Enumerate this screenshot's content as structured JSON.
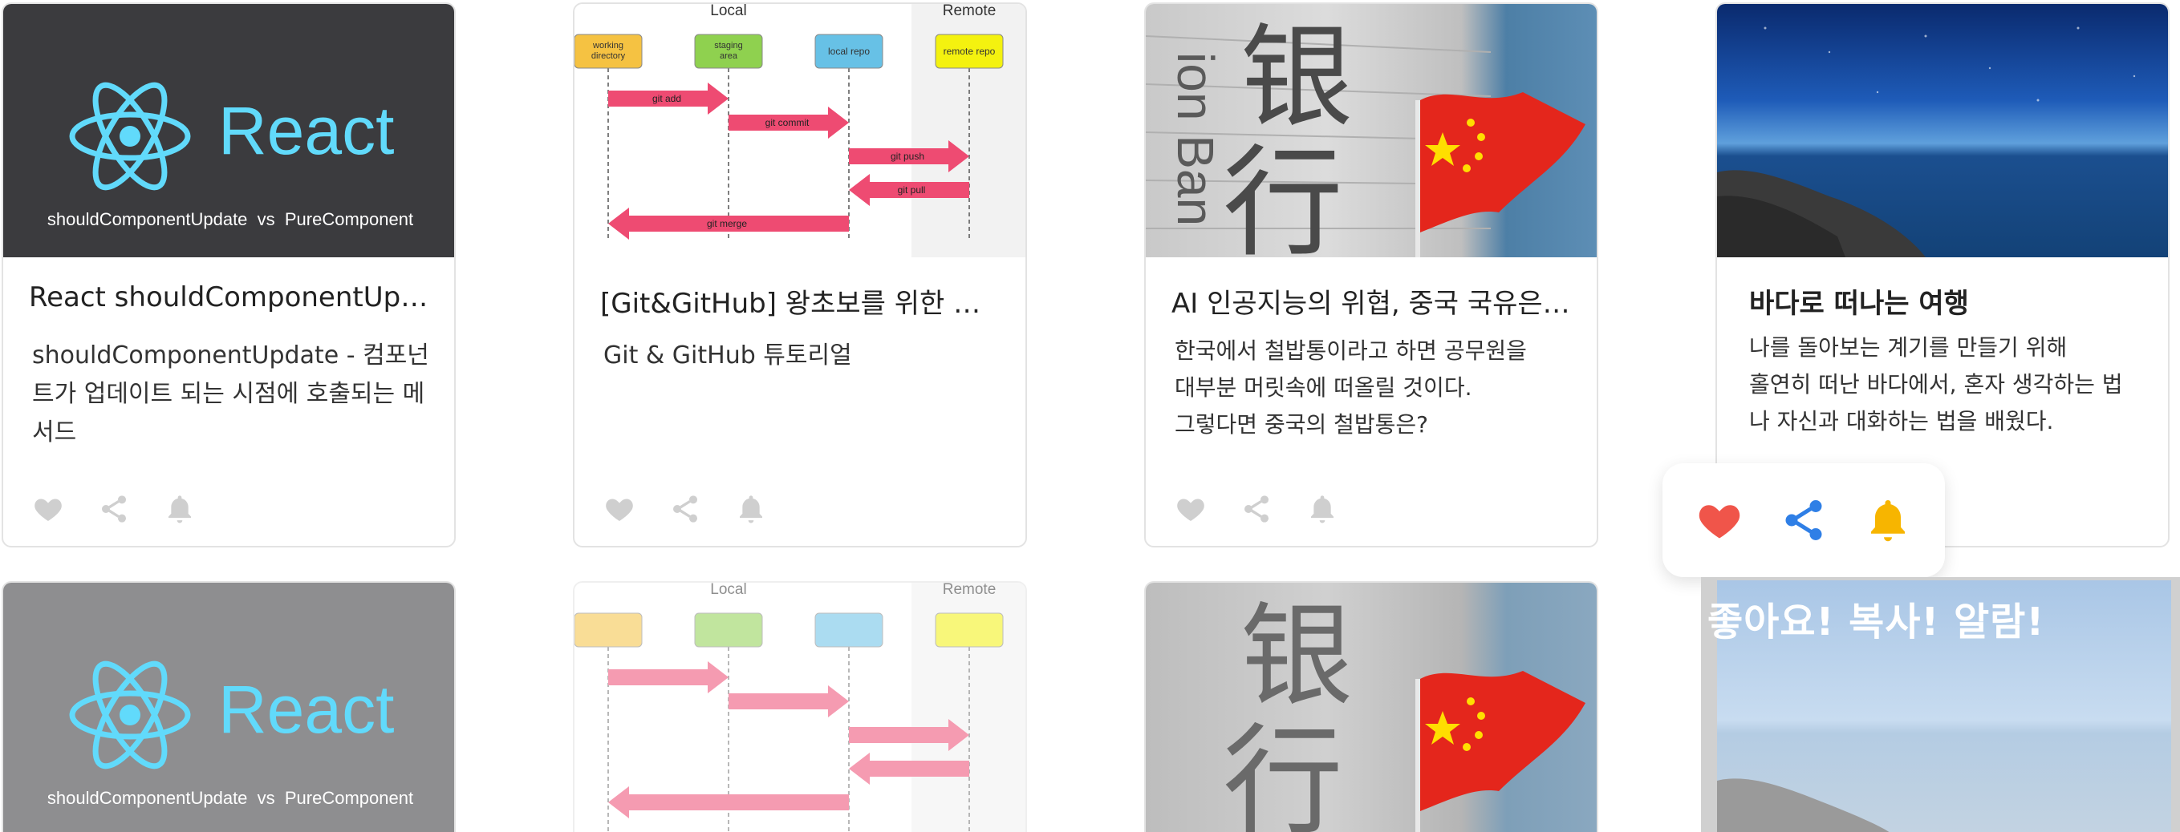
{
  "row1": [
    {
      "title": "React shouldComponentUpda…",
      "desc": "shouldComponentUpdate - 컴포넌트가 업데이트 되는 시점에 호출되는 메서드",
      "thumb": {
        "logo_text": "React",
        "caption": "shouldComponentUpdate  vs  PureComponent"
      }
    },
    {
      "title": "[Git&GitHub] 왕초보를 위한 깃…",
      "desc": "Git & GitHub 튜토리얼",
      "thumb": {
        "local_label": "Local",
        "remote_label": "Remote",
        "boxes": [
          "working directory",
          "staging area",
          "local repo",
          "remote repo"
        ],
        "arrows": [
          "git add",
          "git commit",
          "git push",
          "git pull",
          "git merge"
        ]
      }
    },
    {
      "title": "AI 인공지능의 위협, 중국 국유은…",
      "desc_lines": [
        "한국에서 철밥통이라고 하면 공무원을",
        "대부분 머릿속에 떠올릴 것이다.",
        "그렇다면 중국의 철밥통은?"
      ],
      "thumb": {
        "sign_chars": [
          "银",
          "行"
        ],
        "sign_latin": "ion Ban"
      }
    },
    {
      "title": "바다로 떠나는 여행",
      "desc_lines": [
        "나를 돌아보는 계기를 만들기 위해",
        "홀연히 떠난 바다에서, 혼자 생각하는 법",
        "나 자신과 대화하는 법을 배웠다."
      ]
    }
  ],
  "popup": {
    "like_color": "#f0554a",
    "share_color": "#2f7fe6",
    "bell_color": "#f7b500"
  },
  "banner_text": "좋아요! 복사! 알람!",
  "icons": {
    "heart": "heart-icon",
    "share": "share-icon",
    "bell": "bell-icon"
  },
  "colors": {
    "icon_gray": "#cfcfcf",
    "react_blue": "#61dafb",
    "react_bg": "#3b3b3e",
    "git_arrow": "#ee4b72"
  }
}
